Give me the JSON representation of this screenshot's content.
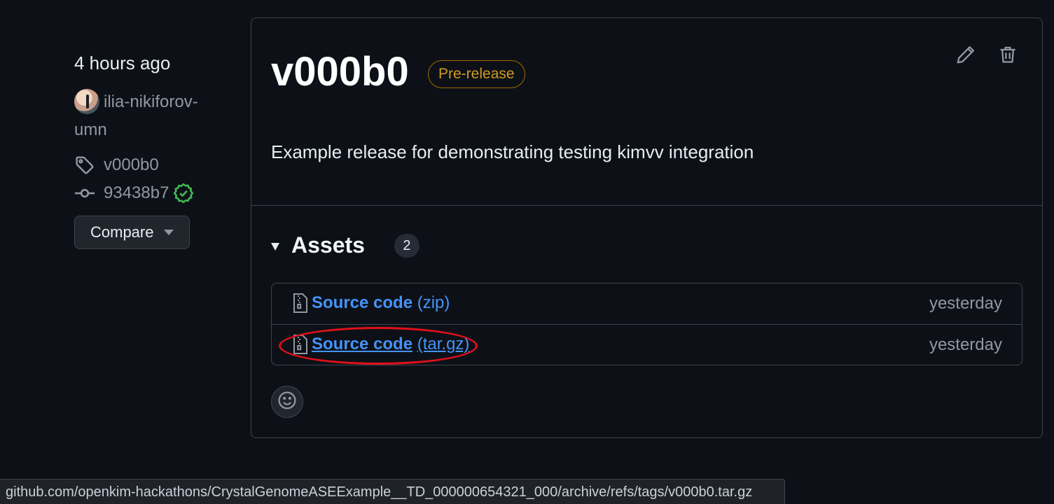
{
  "meta": {
    "time": "4 hours ago",
    "author": "ilia-nikiforov-umn",
    "tag": "v000b0",
    "commit": "93438b7",
    "compare_label": "Compare"
  },
  "release": {
    "title": "v000b0",
    "badge": "Pre-release",
    "description": "Example release for demonstrating testing kimvv integration"
  },
  "assets": {
    "label": "Assets",
    "count": "2",
    "items": [
      {
        "name": "Source code",
        "ext": "(zip)",
        "date": "yesterday"
      },
      {
        "name": "Source code",
        "ext": "(tar.gz)",
        "date": "yesterday"
      }
    ]
  },
  "statusbar": {
    "url": "github.com/openkim-hackathons/CrystalGenomeASEExample__TD_000000654321_000/archive/refs/tags/v000b0.tar.gz"
  },
  "colors": {
    "background": "#0d1117",
    "link": "#4493f8",
    "badge": "#d29922",
    "success": "#3fb950",
    "highlight_ring": "#e0101a"
  },
  "icons": [
    "tag-icon",
    "commit-icon",
    "check-circle-icon",
    "pencil-icon",
    "trash-icon",
    "file-zip-icon",
    "smiley-icon",
    "triangle-down-icon"
  ]
}
